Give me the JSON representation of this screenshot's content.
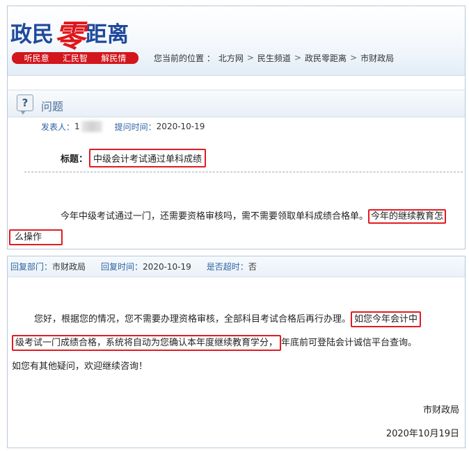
{
  "logo": {
    "part1": "政民",
    "part2": "零",
    "part3": "距离"
  },
  "slogan": [
    "听民意",
    "汇民智",
    "解民情"
  ],
  "location": {
    "label": "您当前的位置 ：",
    "crumbs": [
      "北方网",
      "民生频道",
      "政民零距离",
      "市财政局"
    ],
    "separator": ">"
  },
  "question": {
    "section_title": "问题",
    "poster_label": "发表人：",
    "poster_name": "1",
    "time_label": "提问时间：",
    "time_value": "2020-10-19",
    "title_label": "标题：",
    "title_value": "中级会计考试通过单科成绩",
    "body_part1": "今年中级考试通过一门，还需要资格审核吗，需不需要领取单科成绩合格单。",
    "body_part2": "今年的继续教育怎",
    "body_part3": "么操作"
  },
  "reply": {
    "dept_label": "回复部门：",
    "dept_value": "市财政局",
    "time_label": "回复时间：",
    "time_value": "2020-10-19",
    "overtime_label": "是否超时：",
    "overtime_value": "否",
    "p1_part1": "您好，根据您的情况，您不需要办理资格审核，全部科目考试合格后再行办理。",
    "p1_part2": "如您今年会计中",
    "p2_part1": "级考试一门成绩合格，系统将自动为您确认本年度继续教育学分，",
    "p2_part2": "年底前可登陆会计诚信平台查询。",
    "p3": "如您有其他疑问，欢迎继续咨询！",
    "signature": "市财政局",
    "date": "2020年10月19日"
  },
  "colors": {
    "brand_blue": "#1f4a9c",
    "brand_red": "#d2161c",
    "link_blue": "#2d63a3",
    "highlight": "#e11b22"
  }
}
